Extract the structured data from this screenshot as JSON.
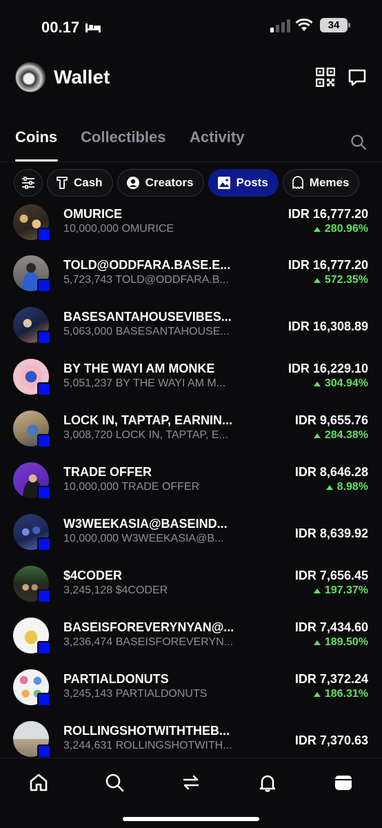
{
  "status_bar": {
    "time": "00.17",
    "battery": "34"
  },
  "header": {
    "title": "Wallet"
  },
  "tabs": [
    {
      "label": "Coins",
      "active": true
    },
    {
      "label": "Collectibles",
      "active": false
    },
    {
      "label": "Activity",
      "active": false
    }
  ],
  "filters": [
    {
      "label": "Cash",
      "icon": "cup-icon"
    },
    {
      "label": "Creators",
      "icon": "person-icon"
    },
    {
      "label": "Posts",
      "icon": "image-icon",
      "active": true
    },
    {
      "label": "Memes",
      "icon": "ghost-icon"
    }
  ],
  "accent_color": "#0c1a8c",
  "positive_color": "#5fe060",
  "coins": [
    {
      "name": "OMURICE",
      "balance": "10,000,000 OMURICE",
      "price": "IDR 16,777.20",
      "change": "280.96%"
    },
    {
      "name": "TOLD@ODDFARA.BASE.E...",
      "balance": "5,723,743 TOLD@ODDFARA.B...",
      "price": "IDR 16,777.20",
      "change": "572.35%"
    },
    {
      "name": "BASESANTAHOUSEVIBES...",
      "balance": "5,063,000 BASESANTAHOUSE...",
      "price": "IDR 16,308.89",
      "change": ""
    },
    {
      "name": "BY THE WAYI AM MONKE",
      "balance": "5,051,237 BY THE WAYI AM M...",
      "price": "IDR 16,229.10",
      "change": "304.94%"
    },
    {
      "name": "LOCK IN, TAPTAP, EARNIN...",
      "balance": "3,008,720 LOCK IN, TAPTAP, E...",
      "price": "IDR 9,655.76",
      "change": "284.38%"
    },
    {
      "name": "TRADE OFFER",
      "balance": "10,000,000 TRADE OFFER",
      "price": "IDR 8,646.28",
      "change": "8.98%"
    },
    {
      "name": "W3WEEKASIA@BASEIND...",
      "balance": "10,000,000 W3WEEKASIA@B...",
      "price": "IDR 8,639.92",
      "change": ""
    },
    {
      "name": "$4CODER",
      "balance": "3,245,128 $4CODER",
      "price": "IDR 7,656.45",
      "change": "197.37%"
    },
    {
      "name": "BASEISFOREVERYNYAN@...",
      "balance": "3,236,474 BASEISFOREVERYN...",
      "price": "IDR 7,434.60",
      "change": "189.50%"
    },
    {
      "name": "PARTIALDONUTS",
      "balance": "3,245,143 PARTIALDONUTS",
      "price": "IDR 7,372.24",
      "change": "186.31%"
    },
    {
      "name": "ROLLINGSHOTWITHTHEB...",
      "balance": "3,244,631 ROLLINGSHOTWITH...",
      "price": "IDR 7,370.63",
      "change": ""
    }
  ],
  "nav": [
    "home-icon",
    "search-icon",
    "swap-icon",
    "bell-icon",
    "wallet-icon"
  ]
}
